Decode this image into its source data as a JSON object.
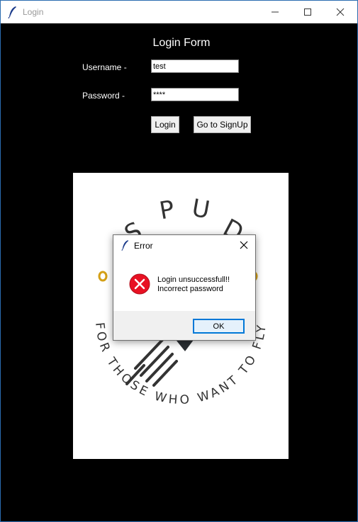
{
  "window": {
    "title": "Login"
  },
  "form": {
    "title": "Login Form",
    "username_label": "Username -",
    "username_value": "test",
    "password_label": "Password -",
    "password_value": "****",
    "login_button": "Login",
    "signup_button": "Go to SignUp"
  },
  "logo": {
    "brand_letters": [
      "S",
      "P",
      "U",
      "D"
    ],
    "tagline": "FOR THOSE WHO WANT TO FLY",
    "accent_color": "#d4a017"
  },
  "dialog": {
    "title": "Error",
    "message_line1": "Login unsuccessfull!!",
    "message_line2": "Incorrect password",
    "ok_button": "OK",
    "icon": "error-icon"
  }
}
